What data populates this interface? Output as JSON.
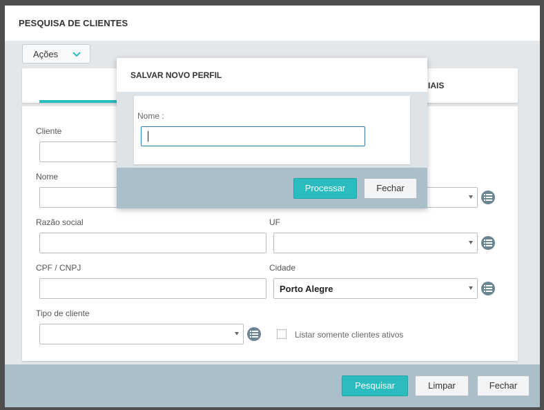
{
  "window": {
    "title": "PESQUISA DE CLIENTES"
  },
  "actions": {
    "label": "Ações"
  },
  "tabs": {
    "right_label_partial": "IAIS"
  },
  "form": {
    "cliente_label": "Cliente",
    "nome_label": "Nome",
    "razao_social_label": "Razão social",
    "uf_label": "UF",
    "uf_value": "",
    "cpf_cnpj_label": "CPF / CNPJ",
    "cidade_label": "Cidade",
    "cidade_value": "Porto Alegre",
    "tipo_cliente_label": "Tipo de cliente",
    "tipo_cliente_value": "",
    "ativos_label": "Listar somente clientes ativos"
  },
  "footer": {
    "pesquisar": "Pesquisar",
    "limpar": "Limpar",
    "fechar": "Fechar"
  },
  "modal": {
    "title": "SALVAR NOVO PERFIL",
    "nome_label": "Nome :",
    "nome_value": "",
    "processar": "Processar",
    "fechar": "Fechar"
  },
  "colors": {
    "accent": "#2bbcbf",
    "footer": "#aabfca",
    "icon": "#6b8593"
  },
  "icons": [
    "chevron-down-icon",
    "list-icon",
    "checkbox-icon"
  ]
}
